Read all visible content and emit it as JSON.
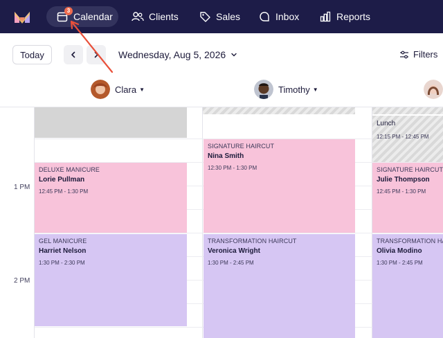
{
  "nav": {
    "items": [
      {
        "label": "Calendar",
        "icon": "calendar-icon",
        "active": true,
        "badge": "3"
      },
      {
        "label": "Clients",
        "icon": "users-icon"
      },
      {
        "label": "Sales",
        "icon": "tag-icon"
      },
      {
        "label": "Inbox",
        "icon": "chat-icon"
      },
      {
        "label": "Reports",
        "icon": "bar-chart-icon"
      }
    ]
  },
  "toolbar": {
    "today_label": "Today",
    "date_label": "Wednesday, Aug 5, 2026",
    "filters_label": "Filters"
  },
  "staff": [
    {
      "name": "Clara"
    },
    {
      "name": "Timothy"
    }
  ],
  "times": [
    "1 PM",
    "2 PM"
  ],
  "appointments": {
    "clara": [
      {
        "service": "DELUXE MANICURE",
        "client": "Lorie Pullman",
        "time": "12:45 PM - 1:30 PM",
        "color": "#f8c3da"
      },
      {
        "service": "GEL MANICURE",
        "client": "Harriet Nelson",
        "time": "1:30 PM - 2:30 PM",
        "color": "#d6c6f3"
      }
    ],
    "timothy": [
      {
        "service": "SIGNATURE HAIRCUT",
        "client": "Nina Smith",
        "time": "12:30 PM - 1:30 PM",
        "color": "#f8c3da"
      },
      {
        "service": "TRANSFORMATION HAIRCUT",
        "client": "Veronica Wright",
        "time": "1:30 PM - 2:45 PM",
        "color": "#d6c6f3"
      }
    ],
    "third": [
      {
        "service": "SIGNATURE HAIRCUT",
        "client": "Julie Thompson",
        "time": "12:45 PM - 1:30 PM",
        "color": "#f8c3da"
      },
      {
        "service": "TRANSFORMATION HAIRCUT",
        "client": "Olivia Modino",
        "time": "1:30 PM - 2:45 PM",
        "color": "#d6c6f3"
      }
    ]
  },
  "lunch": {
    "label": "Lunch",
    "time": "12:15 PM - 12:45 PM"
  }
}
